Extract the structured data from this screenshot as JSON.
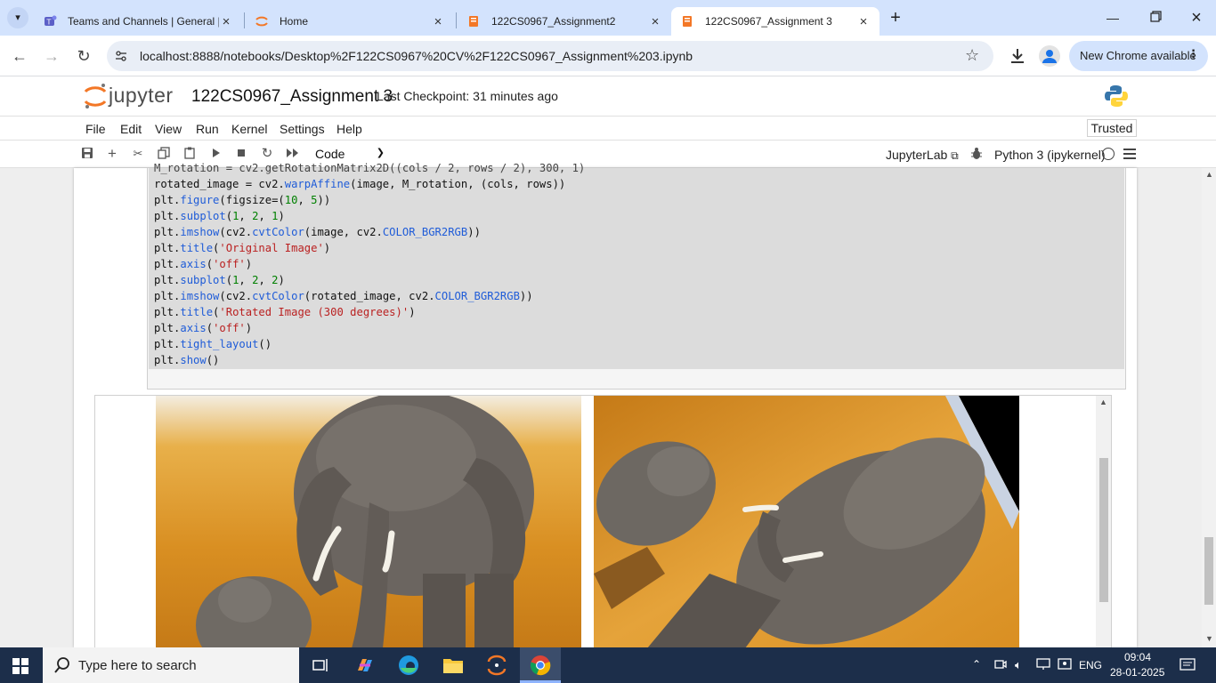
{
  "browser": {
    "tabs": [
      {
        "title": "Teams and Channels | General |",
        "icon": "teams-icon"
      },
      {
        "title": "Home",
        "icon": "jupyter-icon"
      },
      {
        "title": "122CS0967_Assignment2",
        "icon": "notebook-icon"
      },
      {
        "title": "122CS0967_Assignment 3",
        "icon": "notebook-icon",
        "active": true
      }
    ],
    "new_tab": "+",
    "url": "localhost:8888/notebooks/Desktop%2F122CS0967%20CV%2F122CS0967_Assignment%203.ipynb",
    "update_label": "New Chrome available"
  },
  "jupyter": {
    "logo_text": "jupyter",
    "notebook_title": "122CS0967_Assignment 3",
    "checkpoint": "Last Checkpoint: 31 minutes ago",
    "menus": [
      "File",
      "Edit",
      "View",
      "Run",
      "Kernel",
      "Settings",
      "Help"
    ],
    "trusted": "Trusted",
    "cell_type": "Code",
    "jupyterlab_label": "JupyterLab",
    "kernel_name": "Python 3 (ipykernel)"
  },
  "code": {
    "line0": "M_rotation = cv2.getRotationMatrix2D((cols / 2, rows / 2), 300, 1)",
    "line1": {
      "a": "rotated_image = cv2.",
      "f": "warpAffine",
      "b": "(image, M_rotation, (cols, rows))"
    },
    "line2": {
      "a": "plt.",
      "f": "figure",
      "b": "(figsize=(",
      "n1": "10",
      "c": ", ",
      "n2": "5",
      "d": "))"
    },
    "line3": {
      "a": "plt.",
      "f": "subplot",
      "b": "(",
      "n1": "1",
      "c": ", ",
      "n2": "2",
      "d": ", ",
      "n3": "1",
      "e": ")"
    },
    "line4": {
      "a": "plt.",
      "f": "imshow",
      "b": "(cv2.",
      "f2": "cvtColor",
      "c": "(image, cv2.",
      "f3": "COLOR_BGR2RGB",
      "d": "))"
    },
    "line5": {
      "a": "plt.",
      "f": "title",
      "b": "(",
      "s": "'Original Image'",
      "c": ")"
    },
    "line6": {
      "a": "plt.",
      "f": "axis",
      "b": "(",
      "s": "'off'",
      "c": ")"
    },
    "line7": {
      "a": "plt.",
      "f": "subplot",
      "b": "(",
      "n1": "1",
      "c": ", ",
      "n2": "2",
      "d": ", ",
      "n3": "2",
      "e": ")"
    },
    "line8": {
      "a": "plt.",
      "f": "imshow",
      "b": "(cv2.",
      "f2": "cvtColor",
      "c": "(rotated_image, cv2.",
      "f3": "COLOR_BGR2RGB",
      "d": "))"
    },
    "line9": {
      "a": "plt.",
      "f": "title",
      "b": "(",
      "s": "'Rotated Image (300 degrees)'",
      "c": ")"
    },
    "line10": {
      "a": "plt.",
      "f": "axis",
      "b": "(",
      "s": "'off'",
      "c": ")"
    },
    "line11": {
      "a": "plt.",
      "f": "tight_layout",
      "b": "()"
    },
    "line12": {
      "a": "plt.",
      "f": "show",
      "b": "()"
    }
  },
  "output": {
    "images": [
      {
        "subject": "elephant-original-image"
      },
      {
        "subject": "elephant-rotated-image"
      }
    ]
  },
  "taskbar": {
    "search_placeholder": "Type here to search",
    "language": "ENG",
    "time": "09:04",
    "date": "28-01-2025"
  },
  "colors": {
    "tabstrip": "#d3e3fd",
    "taskbar": "#1c2e4a",
    "jupyter_orange": "#f37726",
    "code_function": "#1f5cd8",
    "code_string": "#ba2121",
    "code_number": "#008000"
  }
}
